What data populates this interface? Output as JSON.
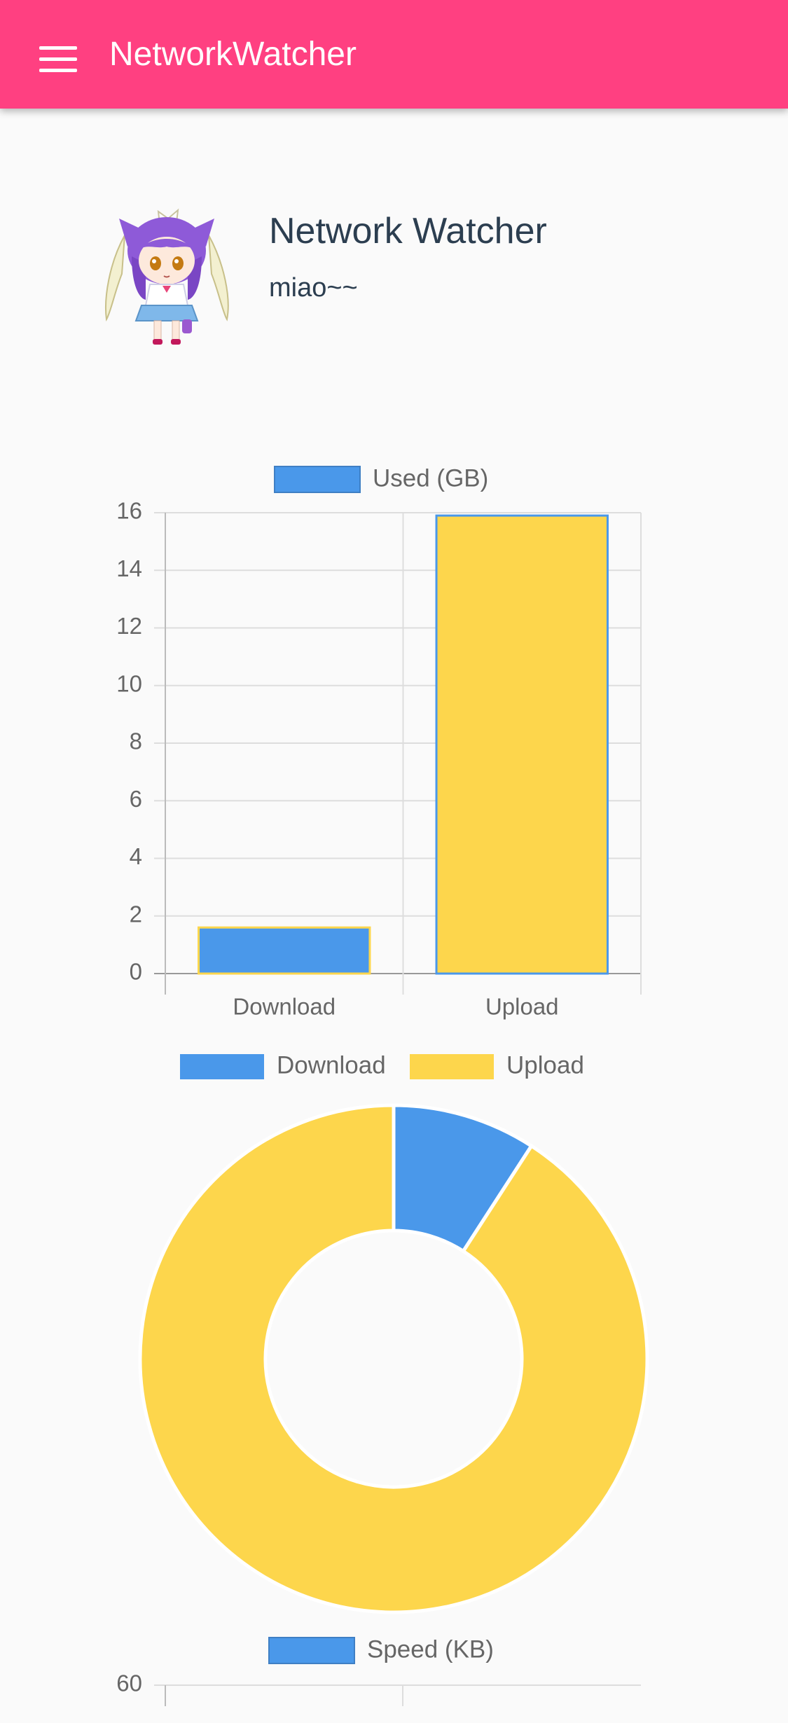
{
  "appbar": {
    "title": "NetworkWatcher",
    "menu_icon": "menu-icon",
    "color": "#ff4081"
  },
  "profile": {
    "name": "Network Watcher",
    "subtitle": "miao~~",
    "avatar_icon": "anime-girl-avatar"
  },
  "colors": {
    "download": "#4a98ea",
    "upload": "#fdd64c",
    "text": "#2c3e50",
    "axis_text": "#666666",
    "grid": "#dddddd"
  },
  "chart_data": [
    {
      "type": "bar",
      "legend": [
        "Used (GB)"
      ],
      "categories": [
        "Download",
        "Upload"
      ],
      "series": [
        {
          "name": "Used (GB)",
          "values": [
            1.6,
            15.9
          ]
        }
      ],
      "ylim": [
        0,
        16
      ],
      "yticks": [
        0,
        2,
        4,
        6,
        8,
        10,
        12,
        14,
        16
      ],
      "grid": true,
      "legend_position": "top"
    },
    {
      "type": "pie",
      "labels": [
        "Download",
        "Upload"
      ],
      "values": [
        1.6,
        15.9
      ],
      "donut": true,
      "legend_position": "top"
    },
    {
      "type": "bar",
      "legend": [
        "Speed (KB)"
      ],
      "categories": [],
      "series": [
        {
          "name": "Speed (KB)",
          "values": []
        }
      ],
      "visible_yticks": [
        60
      ],
      "grid": true,
      "legend_position": "top"
    }
  ]
}
